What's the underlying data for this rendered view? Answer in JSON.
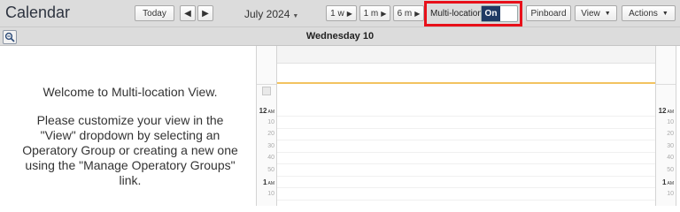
{
  "app": {
    "title": "Calendar"
  },
  "toolbar": {
    "today_label": "Today",
    "prev_icon": "◀",
    "next_icon": "▶",
    "month_label": "July 2024",
    "range_1w": "1 w",
    "range_1m": "1 m",
    "range_6m": "6 m",
    "multilocation_label": "Multi-location",
    "multilocation_state": "On",
    "pinboard_label": "Pinboard",
    "view_label": "View",
    "actions_label": "Actions"
  },
  "day_header": {
    "title": "Wednesday 10"
  },
  "welcome": {
    "line1": "Welcome to Multi-location View.",
    "line2": "Please customize your view in the \"View\" dropdown by selecting an Operatory Group or creating a new one using the \"Manage Operatory Groups\" link."
  },
  "times": [
    {
      "label": "12",
      "suffix": "AM",
      "type": "hour"
    },
    {
      "label": "10",
      "type": "min"
    },
    {
      "label": "20",
      "type": "min"
    },
    {
      "label": "30",
      "type": "min"
    },
    {
      "label": "40",
      "type": "min"
    },
    {
      "label": "50",
      "type": "min"
    },
    {
      "label": "1",
      "suffix": "AM",
      "type": "hour"
    },
    {
      "label": "10",
      "type": "min"
    }
  ],
  "colors": {
    "highlight": "#e8101a",
    "toggle_on": "#1f3a64",
    "now_line": "#f2c360",
    "toolbar_bg": "#dcdcdc"
  },
  "icons": {
    "zoom": "zoom-icon",
    "prev": "chevron-left-icon",
    "next": "chevron-right-icon"
  }
}
